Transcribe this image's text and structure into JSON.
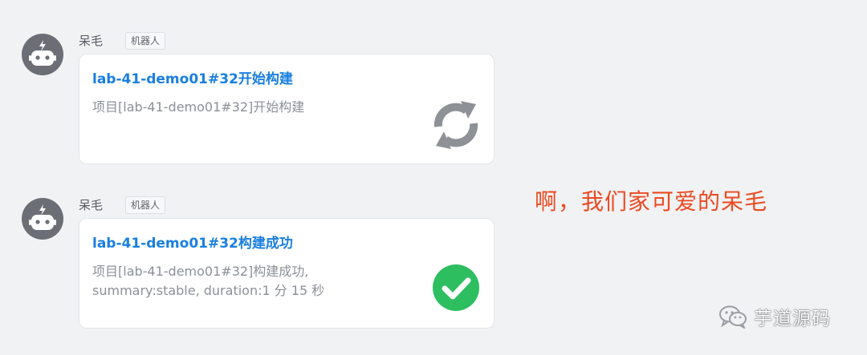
{
  "messages": [
    {
      "sender": "呆毛",
      "badge": "机器人",
      "title": "lab-41-demo01#32开始构建",
      "body_lines": [
        "项目[lab-41-demo01#32]开始构建"
      ],
      "status_icon": "refresh-icon",
      "status_color": "#8e9196"
    },
    {
      "sender": "呆毛",
      "badge": "机器人",
      "title": "lab-41-demo01#32构建成功",
      "body_lines": [
        "项目[lab-41-demo01#32]构建成功,",
        "summary:stable, duration:1 分 15 秒"
      ],
      "status_icon": "success-check-icon",
      "status_color": "#2dbe60"
    }
  ],
  "caption": "啊，我们家可爱的呆毛",
  "watermark": {
    "icon": "wechat-icon",
    "text": "芋道源码"
  },
  "colors": {
    "background": "#f1f2f4",
    "link": "#1a7fe0",
    "caption": "#ec4a21",
    "avatar": "#6b6f75"
  }
}
